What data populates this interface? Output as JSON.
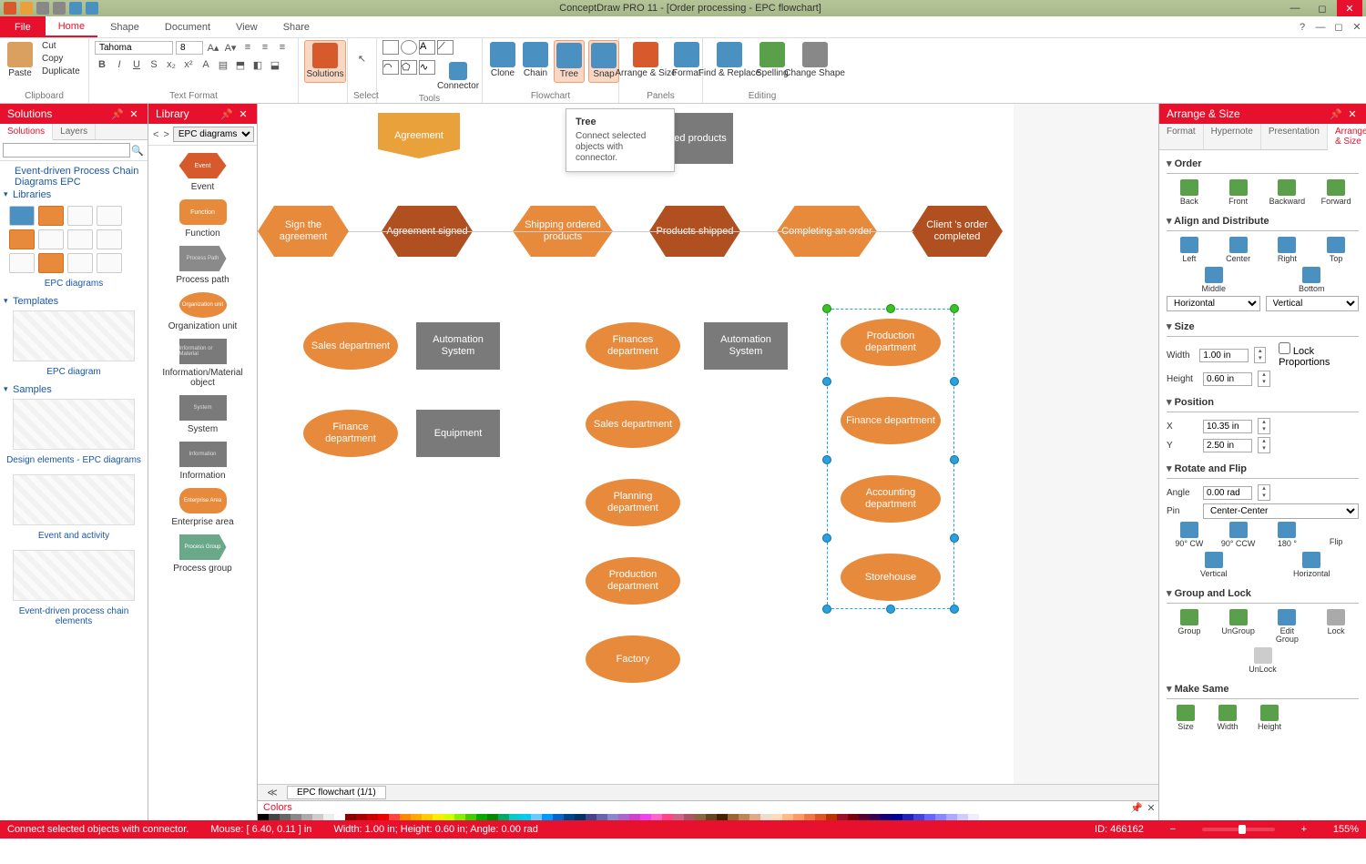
{
  "app": {
    "title": "ConceptDraw PRO 11 - [Order processing - EPC flowchart]"
  },
  "menu": {
    "file": "File",
    "tabs": [
      "Home",
      "Shape",
      "Document",
      "View",
      "Share"
    ],
    "active": "Home"
  },
  "ribbon": {
    "clipboard": {
      "paste": "Paste",
      "cut": "Cut",
      "copy": "Copy",
      "duplicate": "Duplicate",
      "label": "Clipboard"
    },
    "textformat": {
      "font": "Tahoma",
      "size": "8",
      "label": "Text Format"
    },
    "solutions": {
      "btn": "Solutions",
      "label": ""
    },
    "select": {
      "label": "Select"
    },
    "tools": {
      "connector": "Connector",
      "label": "Tools"
    },
    "flowchart": {
      "clone": "Clone",
      "chain": "Chain",
      "tree": "Tree",
      "snap": "Snap",
      "label": "Flowchart"
    },
    "panels": {
      "arrange": "Arrange & Size",
      "format": "Format",
      "label": "Panels"
    },
    "editing": {
      "find": "Find & Replace",
      "spelling": "Spelling",
      "change": "Change Shape",
      "label": "Editing"
    }
  },
  "tooltip": {
    "title": "Tree",
    "body": "Connect selected objects with connector."
  },
  "solutions": {
    "title": "Solutions",
    "tabs": [
      "Solutions",
      "Layers"
    ],
    "root": "Event-driven Process Chain Diagrams EPC",
    "sections": {
      "libraries": "Libraries",
      "lib_name": "EPC diagrams",
      "templates": "Templates",
      "tmpl_name": "EPC diagram",
      "samples": "Samples",
      "sample1": "Design elements - EPC diagrams",
      "sample2": "Event and activity",
      "sample3": "Event-driven process chain elements"
    }
  },
  "library": {
    "title": "Library",
    "combo": "EPC diagrams",
    "items": [
      {
        "label": "Event",
        "cls": "hex",
        "inner": "Event"
      },
      {
        "label": "Function",
        "cls": "round",
        "inner": "Function"
      },
      {
        "label": "Process path",
        "cls": "arrow",
        "inner": "Process Path"
      },
      {
        "label": "Organization unit",
        "cls": "ell",
        "inner": "Organization unit"
      },
      {
        "label": "Information/Material object",
        "cls": "rect",
        "inner": "Information or Material"
      },
      {
        "label": "System",
        "cls": "rect",
        "inner": "System"
      },
      {
        "label": "Information",
        "cls": "rect",
        "inner": "Information"
      },
      {
        "label": "Enterprise area",
        "cls": "roundrect",
        "inner": "Enterprise Area"
      },
      {
        "label": "Process group",
        "cls": "arrow2",
        "inner": "Process Group"
      }
    ]
  },
  "canvas": {
    "sheet_tab": "EPC flowchart (1/1)",
    "shapes": {
      "agreement": "Agreement",
      "ordered_products": "Ordered products",
      "sign": "Sign the agreement",
      "signed": "Agreement signed",
      "shipping": "Shipping ordered products",
      "shipped": "Products shipped",
      "completing": "Completing an order",
      "client": "Client 's order completed",
      "sales": "Sales department",
      "auto1": "Automation System",
      "finance": "Finance department",
      "equip": "Equipment",
      "finances_dept": "Finances department",
      "auto2": "Automation System",
      "sales2": "Sales department",
      "planning": "Planning department",
      "production": "Production department",
      "factory": "Factory",
      "prod2": "Production department",
      "fin2": "Finance department",
      "acct": "Accounting department",
      "store": "Storehouse"
    }
  },
  "right": {
    "title": "Arrange & Size",
    "tabs": [
      "Format",
      "Hypernote",
      "Presentation",
      "Arrange & Size"
    ],
    "order": {
      "head": "Order",
      "back": "Back",
      "front": "Front",
      "backward": "Backward",
      "forward": "Forward"
    },
    "align": {
      "head": "Align and Distribute",
      "left": "Left",
      "center": "Center",
      "right": "Right",
      "top": "Top",
      "middle": "Middle",
      "bottom": "Bottom",
      "horiz": "Horizontal",
      "vert": "Vertical"
    },
    "size": {
      "head": "Size",
      "w": "Width",
      "h": "Height",
      "wv": "1.00 in",
      "hv": "0.60 in",
      "lock": "Lock Proportions"
    },
    "pos": {
      "head": "Position",
      "x": "X",
      "y": "Y",
      "xv": "10.35 in",
      "yv": "2.50 in"
    },
    "rotate": {
      "head": "Rotate and Flip",
      "angle": "Angle",
      "av": "0.00 rad",
      "pin": "Pin",
      "pv": "Center-Center",
      "cw": "90° CW",
      "ccw": "90° CCW",
      "r180": "180 °",
      "flip": "Flip",
      "fv": "Vertical",
      "fh": "Horizontal"
    },
    "group": {
      "head": "Group and Lock",
      "group": "Group",
      "ungroup": "UnGroup",
      "edit": "Edit Group",
      "lock": "Lock",
      "unlock": "UnLock"
    },
    "make": {
      "head": "Make Same",
      "size": "Size",
      "width": "Width",
      "height": "Height"
    }
  },
  "colors": {
    "title": "Colors"
  },
  "status": {
    "hint": "Connect selected objects with connector.",
    "mouse": "Mouse: [ 6.40, 0.11 ] in",
    "dims": "Width: 1.00 in;  Height: 0.60 in;  Angle: 0.00 rad",
    "id": "ID: 466162",
    "zoom": "155%"
  }
}
